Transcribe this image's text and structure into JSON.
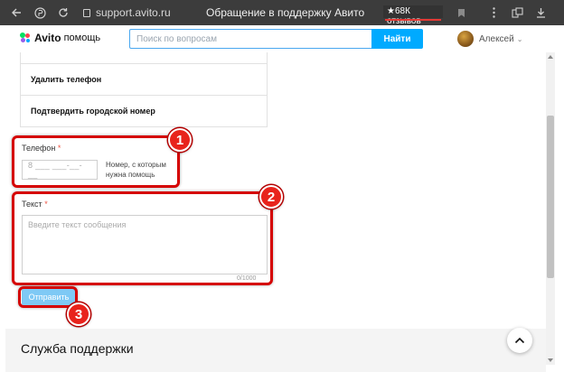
{
  "browser": {
    "url": "support.avito.ru",
    "tab_title": "Обращение в поддержку Авито",
    "reviews_badge": "★68К отзывов"
  },
  "header": {
    "logo_text": "Avito",
    "logo_sub": "помощь",
    "search_placeholder": "Поиск по вопросам",
    "search_button": "Найти",
    "user_name": "Алексей"
  },
  "options": [
    "Удалить телефон",
    "Подтвердить городской номер"
  ],
  "form": {
    "phone_label": "Телефон",
    "required_mark": "*",
    "phone_placeholder": "8 ___ ___-__-__",
    "phone_hint": "Номер, с которым нужна помощь",
    "text_label": "Текст",
    "text_placeholder": "Введите текст сообщения",
    "char_count": "0/1000",
    "submit_label": "Отправить"
  },
  "markers": [
    "1",
    "2",
    "3"
  ],
  "support": {
    "title": "Служба поддержки"
  },
  "colors": {
    "accent": "#00aaff",
    "highlight": "#d50000",
    "marker": "#e8231c"
  }
}
